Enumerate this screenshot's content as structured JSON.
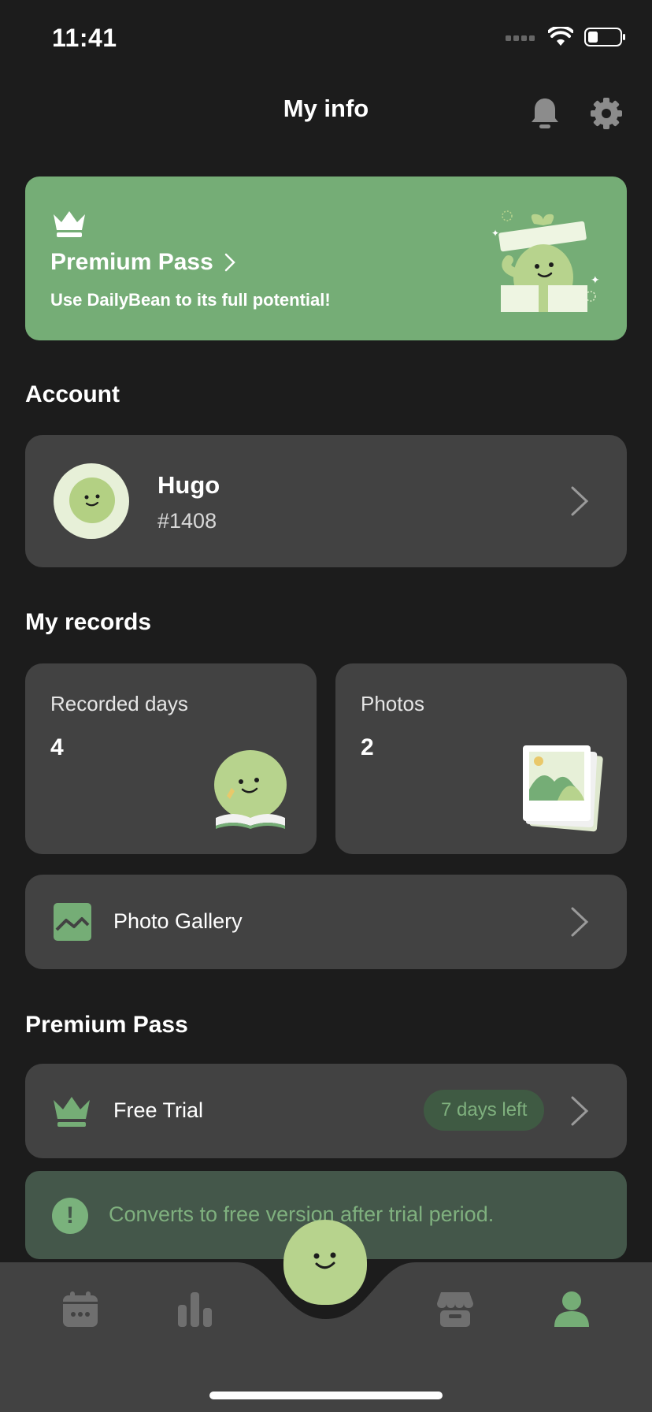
{
  "status_bar": {
    "time": "11:41"
  },
  "header": {
    "title": "My info"
  },
  "premium_banner": {
    "title": "Premium Pass",
    "subtitle": "Use DailyBean to its full potential!"
  },
  "account": {
    "heading": "Account",
    "name": "Hugo",
    "id": "#1408"
  },
  "records": {
    "heading": "My records",
    "recorded_days_label": "Recorded days",
    "recorded_days_value": "4",
    "photos_label": "Photos",
    "photos_value": "2",
    "gallery_label": "Photo Gallery"
  },
  "premium": {
    "heading": "Premium Pass",
    "free_trial_label": "Free Trial",
    "badge": "7 days left",
    "notice": "Converts to free version after trial period."
  },
  "tab_bar": {
    "tabs": [
      {
        "icon": "calendar-icon",
        "active": false
      },
      {
        "icon": "stats-icon",
        "active": false
      },
      {
        "icon": "bean-icon",
        "active": false
      },
      {
        "icon": "store-icon",
        "active": false
      },
      {
        "icon": "profile-icon",
        "active": true
      }
    ]
  },
  "colors": {
    "background": "#1c1c1c",
    "card": "#424242",
    "accent_green": "#75ad76",
    "bean_green": "#b7d38d"
  }
}
